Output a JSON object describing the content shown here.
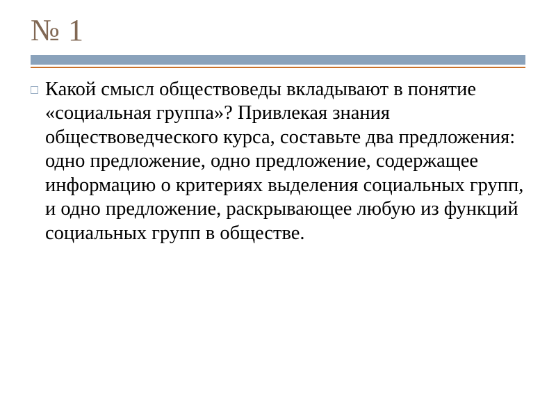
{
  "slide": {
    "title": "№ 1",
    "paragraph": "Какой смысл обществоведы вкладывают в понятие «социальная группа»? Привлекая знания обществоведческого курса, составьте два предложения: одно предложение, одно предложение, содержащее информацию о критериях выделения социальных групп, и одно предложение, раскрывающее любую из функций социальных групп в обществе."
  }
}
